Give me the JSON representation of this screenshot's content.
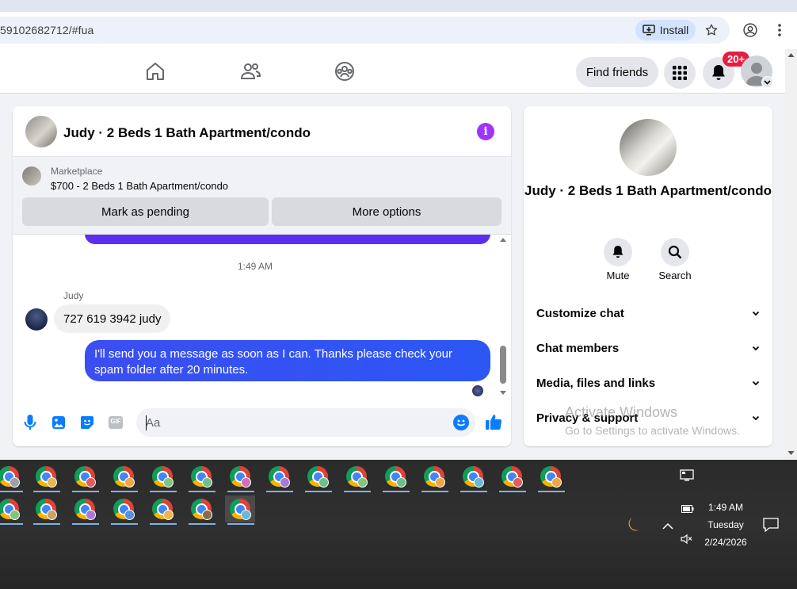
{
  "browser": {
    "url": "59102682712/#fua",
    "install_label": "Install"
  },
  "header": {
    "find_friends_label": "Find friends",
    "notifications_badge": "20+"
  },
  "chat": {
    "title": "Judy · 2 Beds 1 Bath Apartment/condo",
    "marketplace": {
      "label": "Marketplace",
      "item": "$700 - 2 Beds 1 Bath Apartment/condo",
      "mark_pending_label": "Mark as pending",
      "more_options_label": "More options"
    },
    "timestamp": "1:49 AM",
    "sender_name": "Judy",
    "messages": [
      {
        "from": "Judy",
        "text": "727 619 3942 judy"
      },
      {
        "from": "me",
        "text": "I'll send you a message as soon as I can. Thanks please check your spam folder after 20 minutes."
      }
    ],
    "composer_placeholder": "Aa",
    "gif_label": "GIF"
  },
  "info_panel": {
    "name": "Judy · 2 Beds 1 Bath Apartment/condo",
    "mute_label": "Mute",
    "search_label": "Search",
    "sections": [
      "Customize chat",
      "Chat members",
      "Media, files and links",
      "Privacy & support"
    ]
  },
  "watermark": {
    "line1": "Activate Windows",
    "line2": "Go to Settings to activate Windows."
  },
  "taskbar": {
    "time": "1:49 AM",
    "day": "Tuesday",
    "date": "2/24/2026"
  },
  "colors": {
    "messenger_blue": "#2c57f4",
    "info_purple": "#a033ff",
    "badge_red": "#e41e3f",
    "like_blue": "#0a7cff"
  }
}
